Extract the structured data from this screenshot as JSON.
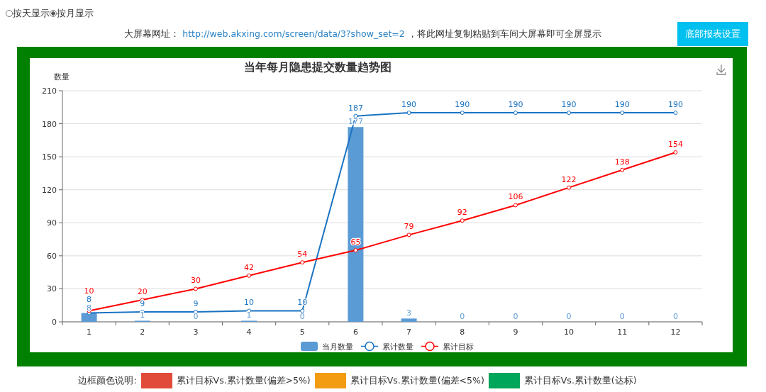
{
  "view_options": [
    {
      "label": "按天显示",
      "selected": false
    },
    {
      "label": "按月显示",
      "selected": true
    }
  ],
  "screen_url": {
    "label": "大屏幕网址：",
    "url": "http://web.akxing.com/screen/data/3?show_set=2",
    "note": "，将此网址复制粘贴到车间大屏幕即可全屏显示"
  },
  "settings_button": "底部报表设置",
  "panel": {
    "chart_data": {
      "type": "bar",
      "title": "当年每月隐患提交数量趋势图",
      "ylabel": "数量",
      "categories": [
        "1",
        "2",
        "3",
        "4",
        "5",
        "6",
        "7",
        "8",
        "9",
        "10",
        "11",
        "12"
      ],
      "ylim": [
        0,
        210
      ],
      "yticks": [
        0,
        30,
        60,
        90,
        120,
        150,
        180,
        210
      ],
      "data_labels": true,
      "grid": true,
      "legend": true,
      "series": [
        {
          "name": "当月数量",
          "type": "bar",
          "color": "#5b9bd5",
          "values": [
            8,
            1,
            0,
            1,
            0,
            177,
            3,
            0,
            0,
            0,
            0,
            0
          ]
        },
        {
          "name": "累计数量",
          "type": "line",
          "marker": "circle",
          "color": "#1a73c2",
          "values": [
            8,
            9,
            9,
            10,
            10,
            187,
            190,
            190,
            190,
            190,
            190,
            190
          ]
        },
        {
          "name": "累计目标",
          "type": "line",
          "marker": "circle",
          "color": "#ff0000",
          "values": [
            10,
            20,
            30,
            42,
            54,
            65,
            79,
            92,
            106,
            122,
            138,
            154
          ]
        }
      ]
    }
  },
  "legend": {
    "label": "边框颜色说明:",
    "items": [
      {
        "label": "累计目标Vs.累计数量(偏差>5%)",
        "color": "#e04b3a"
      },
      {
        "label": "累计目标Vs.累计数量(偏差<5%)",
        "color": "#f39c12"
      },
      {
        "label": "累计目标Vs.累计数量(达标)",
        "color": "#00a65a"
      }
    ]
  }
}
